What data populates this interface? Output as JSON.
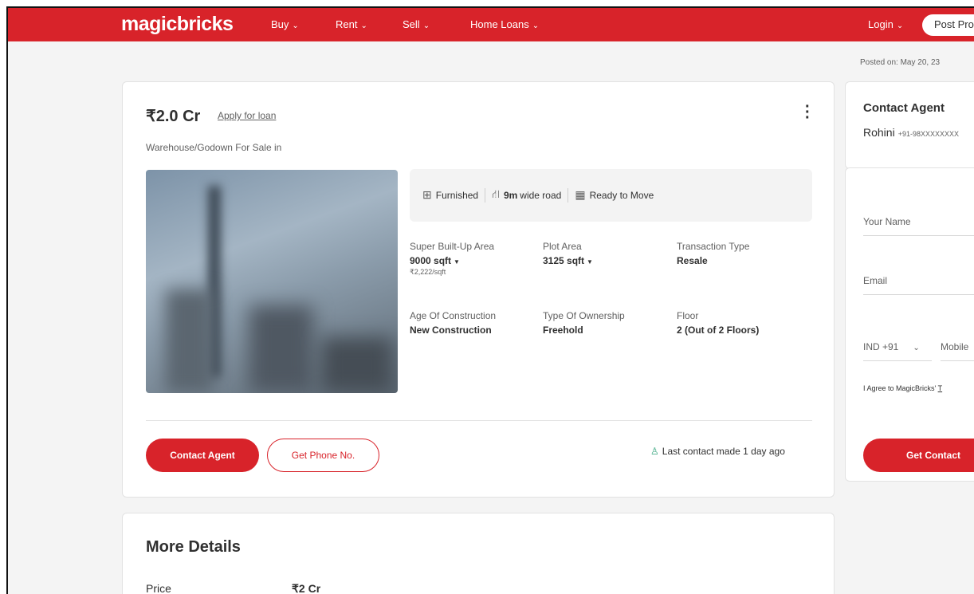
{
  "header": {
    "logo": "magicbricks",
    "nav": [
      {
        "label": "Buy"
      },
      {
        "label": "Rent"
      },
      {
        "label": "Sell"
      },
      {
        "label": "Home Loans"
      }
    ],
    "login": "Login",
    "post_property": "Post Pro",
    "brand_color": "#d8232a"
  },
  "posted_on": "Posted on: May 20, 23",
  "listing": {
    "price": "₹2.0 Cr",
    "apply_loan": "Apply for loan",
    "subtitle": "Warehouse/Godown For Sale in",
    "features": {
      "furnished": "Furnished",
      "road_value": "9m",
      "road_text": "wide road",
      "status": "Ready to Move"
    },
    "details": {
      "super_area_label": "Super Built-Up Area",
      "super_area_value": "9000 sqft",
      "super_area_rate": "₹2,222/sqft",
      "plot_area_label": "Plot Area",
      "plot_area_value": "3125 sqft",
      "transaction_label": "Transaction Type",
      "transaction_value": "Resale",
      "age_label": "Age Of Construction",
      "age_value": "New Construction",
      "ownership_label": "Type Of Ownership",
      "ownership_value": "Freehold",
      "floor_label": "Floor",
      "floor_value": "2 (Out of 2 Floors)"
    },
    "contact_agent_btn": "Contact Agent",
    "get_phone_btn": "Get Phone No.",
    "last_contact": "Last contact made 1 day ago"
  },
  "more_details": {
    "title": "More Details",
    "price_label": "Price",
    "price_value": "₹2 Cr"
  },
  "sidebar": {
    "contact_title": "Contact Agent",
    "agent_name": "Rohini",
    "agent_phone": "+91-98XXXXXXXX",
    "form": {
      "name_placeholder": "Your Name",
      "email_placeholder": "Email",
      "country_code": "IND +91",
      "mobile_placeholder": "Mobile",
      "agree_text": "I Agree to MagicBricks'",
      "agree_link": "T",
      "submit": "Get Contact"
    }
  }
}
